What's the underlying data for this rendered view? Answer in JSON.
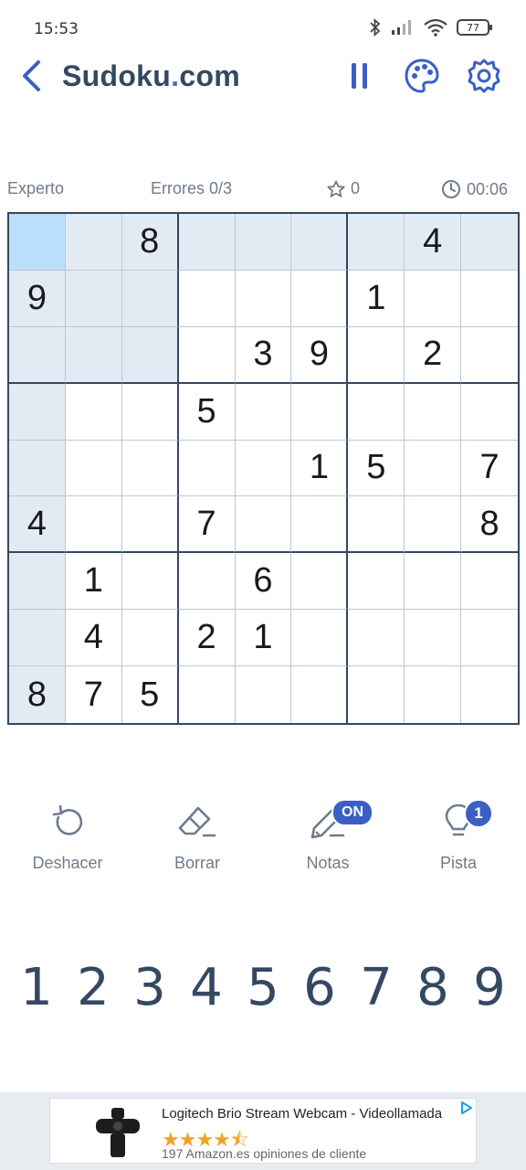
{
  "status": {
    "time": "15:53",
    "battery": "77"
  },
  "header": {
    "title_main": "Sudoku",
    "title_dot": ".",
    "title_tld": "com"
  },
  "info": {
    "difficulty": "Experto",
    "errors": "Errores 0/3",
    "score": "0",
    "timer": "00:06"
  },
  "grid": {
    "rows": [
      [
        "",
        "",
        "8",
        "",
        "",
        "",
        "",
        "4",
        ""
      ],
      [
        "9",
        "",
        "",
        "",
        "",
        "",
        "1",
        "",
        ""
      ],
      [
        "",
        "",
        "",
        "",
        "3",
        "9",
        "",
        "2",
        ""
      ],
      [
        "",
        "",
        "",
        "5",
        "",
        "",
        "",
        "",
        ""
      ],
      [
        "",
        "",
        "",
        "",
        "",
        "1",
        "5",
        "",
        "7"
      ],
      [
        "4",
        "",
        "",
        "7",
        "",
        "",
        "",
        "",
        "8"
      ],
      [
        "",
        "1",
        "",
        "",
        "6",
        "",
        "",
        "",
        ""
      ],
      [
        "",
        "4",
        "",
        "2",
        "1",
        "",
        "",
        "",
        ""
      ],
      [
        "8",
        "7",
        "5",
        "",
        "",
        "",
        "",
        "",
        ""
      ]
    ],
    "selected": [
      0,
      0
    ],
    "colors": {
      "selected": "#bbdefb",
      "highlight": "#e2ebf3",
      "border": "#344861"
    }
  },
  "tools": {
    "undo": "Deshacer",
    "erase": "Borrar",
    "notes": "Notas",
    "notes_badge": "ON",
    "hint": "Pista",
    "hint_badge": "1"
  },
  "numpad": [
    "1",
    "2",
    "3",
    "4",
    "5",
    "6",
    "7",
    "8",
    "9"
  ],
  "ad": {
    "title": "Logitech Brio Stream Webcam - Videollamada",
    "stars": "★★★★⯪",
    "reviews": "197 Amazon.es opiniones de cliente"
  },
  "colors": {
    "accent": "#3b5fc4",
    "text": "#344861",
    "muted": "#6e7c8c"
  }
}
